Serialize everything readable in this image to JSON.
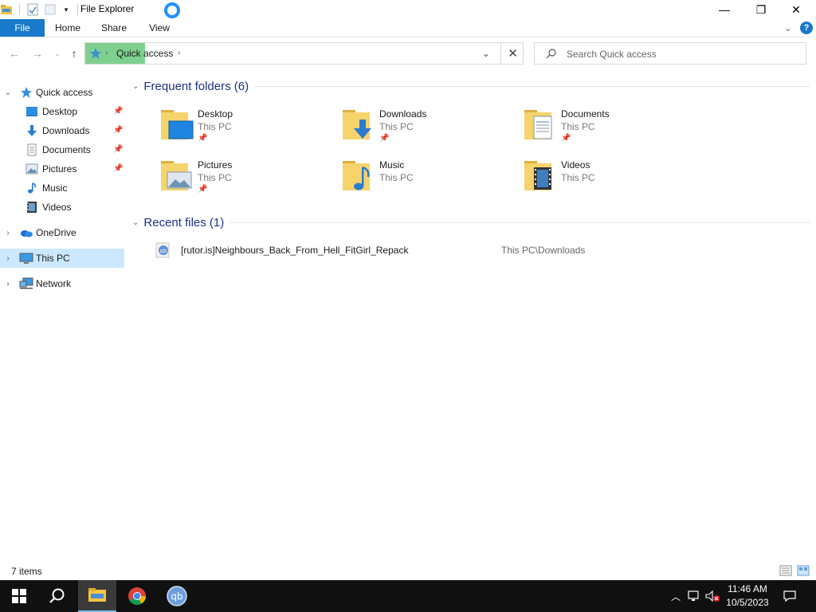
{
  "window": {
    "title": "File Explorer",
    "minimize_glyph": "—",
    "restore_glyph": "❐",
    "close_glyph": "✕"
  },
  "ribbon": {
    "tabs": [
      {
        "label": "File",
        "active": true
      },
      {
        "label": "Home",
        "active": false
      },
      {
        "label": "Share",
        "active": false
      },
      {
        "label": "View",
        "active": false
      }
    ],
    "help_label": "?"
  },
  "navigation": {
    "breadcrumb": [
      {
        "label": "Quick access"
      }
    ],
    "search_placeholder": "Search Quick access"
  },
  "sidebar": {
    "items": [
      {
        "label": "Quick access",
        "icon": "star-icon",
        "expanded": true,
        "selected": false
      },
      {
        "label": "Desktop",
        "icon": "desktop-icon",
        "pinned": true
      },
      {
        "label": "Downloads",
        "icon": "downloads-icon",
        "pinned": true
      },
      {
        "label": "Documents",
        "icon": "documents-icon",
        "pinned": true
      },
      {
        "label": "Pictures",
        "icon": "pictures-icon",
        "pinned": true
      },
      {
        "label": "Music",
        "icon": "music-icon",
        "pinned": false
      },
      {
        "label": "Videos",
        "icon": "videos-icon",
        "pinned": false
      },
      {
        "label": "OneDrive",
        "icon": "onedrive-icon",
        "expanded": false
      },
      {
        "label": "This PC",
        "icon": "this-pc-icon",
        "expanded": false,
        "selected": true
      },
      {
        "label": "Network",
        "icon": "network-icon",
        "expanded": false
      }
    ]
  },
  "frequent_folders": {
    "header": "Frequent folders (6)",
    "items": [
      {
        "name": "Desktop",
        "location": "This PC",
        "pinned": true,
        "icon": "desktop-folder-icon"
      },
      {
        "name": "Downloads",
        "location": "This PC",
        "pinned": true,
        "icon": "downloads-folder-icon"
      },
      {
        "name": "Documents",
        "location": "This PC",
        "pinned": true,
        "icon": "documents-folder-icon"
      },
      {
        "name": "Pictures",
        "location": "This PC",
        "pinned": true,
        "icon": "pictures-folder-icon"
      },
      {
        "name": "Music",
        "location": "This PC",
        "pinned": false,
        "icon": "music-folder-icon"
      },
      {
        "name": "Videos",
        "location": "This PC",
        "pinned": false,
        "icon": "videos-folder-icon"
      }
    ]
  },
  "recent_files": {
    "header": "Recent files (1)",
    "items": [
      {
        "name": "[rutor.is]Neighbours_Back_From_Hell_FitGirl_Repack",
        "path": "This PC\\Downloads",
        "icon": "qbittorrent-file-icon"
      }
    ]
  },
  "status": {
    "item_count": "7 items"
  },
  "taskbar": {
    "apps": [
      "start-icon",
      "search-icon",
      "file-explorer-icon",
      "chrome-icon",
      "qbittorrent-icon"
    ],
    "time": "11:46 AM",
    "date": "10/5/2023"
  },
  "colors": {
    "accent": "#1979ca",
    "selection": "#cce8ff",
    "header_text": "#1e3287",
    "address_highlight": "#7ed08e",
    "taskbar": "#101010"
  }
}
